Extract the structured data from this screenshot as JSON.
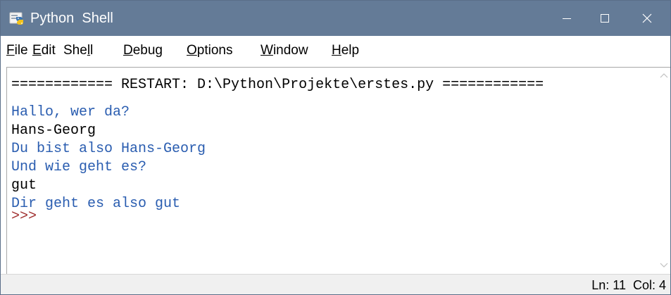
{
  "window": {
    "title": "Python  Shell",
    "icon": "python-idle-icon",
    "controls": [
      "minimize-icon",
      "maximize-icon",
      "close-icon"
    ],
    "titlebar_color": "#647b97"
  },
  "menu": {
    "items": [
      {
        "underline": "F",
        "rest": "ile"
      },
      {
        "underline": "E",
        "rest": "dit"
      },
      {
        "pre": "She",
        "underline": "l",
        "rest": "l"
      },
      {
        "underline": "D",
        "rest": "ebug"
      },
      {
        "underline": "O",
        "rest": "ptions"
      },
      {
        "underline": "W",
        "rest": "indow"
      },
      {
        "underline": "H",
        "rest": "elp"
      }
    ]
  },
  "shell": {
    "lines": [
      {
        "text": "============ RESTART: D:\\Python\\Projekte\\erstes.py ============",
        "color": "#000000"
      },
      {
        "text": "Hallo, wer da?",
        "color": "#2a5db0"
      },
      {
        "text": "Hans-Georg",
        "color": "#000000"
      },
      {
        "text": "Du bist also Hans-Georg",
        "color": "#2a5db0"
      },
      {
        "text": "Und wie geht es?",
        "color": "#2a5db0"
      },
      {
        "text": "gut",
        "color": "#000000"
      },
      {
        "text": "Dir geht es also gut",
        "color": "#2a5db0"
      },
      {
        "text": ">>>",
        "color": "#a03030"
      }
    ]
  },
  "status": {
    "text": "Ln: 11  Col: 4"
  }
}
